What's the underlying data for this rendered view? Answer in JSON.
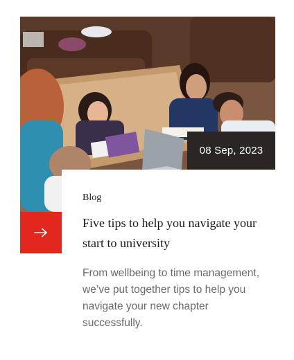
{
  "card": {
    "date": "08 Sep, 2023",
    "category": "Blog",
    "title": "Five tips to help you navigate your start to university",
    "excerpt": "From wellbeing to time management, we’ve put together tips to help you navigate your new chapter successfully.",
    "image_alt_icon": "students-photo-icon",
    "arrow_icon": "arrow-right-icon"
  },
  "colors": {
    "accent": "#e1271e",
    "badge_bg": "#2b2523",
    "text": "#1a1a1a",
    "muted": "#6a6a6a"
  }
}
